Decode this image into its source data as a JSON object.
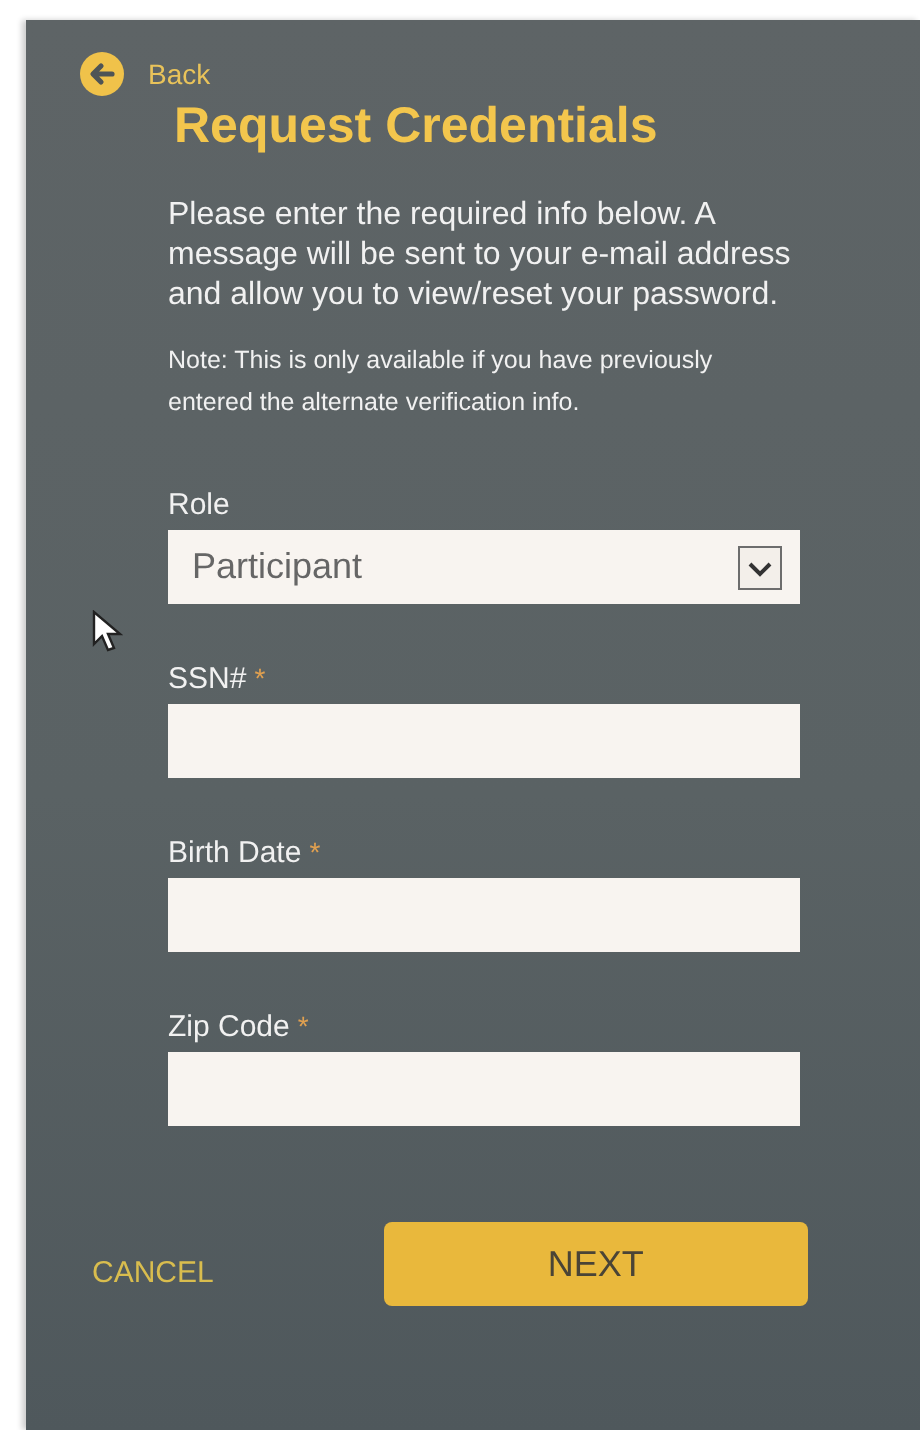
{
  "back": {
    "label": "Back"
  },
  "title": "Request Credentials",
  "intro": "Please enter the required info below. A message will be sent to your e-mail address and allow you to view/reset your password.",
  "note": "Note: This is only available if you have previously entered the alternate verification info.",
  "fields": [
    {
      "kind": "select",
      "label": "Role",
      "value": "Participant"
    },
    {
      "kind": "text",
      "label": "SSN#",
      "required_mark": "*"
    },
    {
      "kind": "text",
      "label": "Birth Date",
      "required_mark": "*"
    },
    {
      "kind": "text",
      "label": "Zip Code",
      "required_mark": "*"
    }
  ],
  "buttons": {
    "cancel": "CANCEL",
    "next": "NEXT"
  }
}
